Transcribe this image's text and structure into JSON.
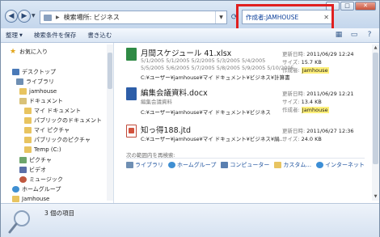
{
  "window": {
    "controls": {
      "minimize": "–",
      "maximize": "□",
      "close": "✕"
    }
  },
  "address_bar": {
    "breadcrumb": "検索場所: ビジネス"
  },
  "search": {
    "value": "作成者:JAMHOUSE",
    "highlight_color": "#e02020"
  },
  "toolbar": {
    "organize": "整理",
    "save_search": "検索条件を保存",
    "burn": "書き込む"
  },
  "sidebar": {
    "items": [
      {
        "label": "お気に入り",
        "icon": "star-icon"
      },
      {
        "label": "デスクトップ",
        "icon": "desktop-icon"
      },
      {
        "label": "ライブラリ",
        "icon": "library-icon"
      },
      {
        "label": "jamhouse",
        "icon": "user-folder-icon"
      },
      {
        "label": "ドキュメント",
        "icon": "documents-icon"
      },
      {
        "label": "マイ ドキュメント",
        "icon": "folder-icon"
      },
      {
        "label": "パブリックのドキュメント",
        "icon": "folder-icon"
      },
      {
        "label": "マイ ピクチャ",
        "icon": "folder-icon"
      },
      {
        "label": "パブリックのピクチャ",
        "icon": "folder-icon"
      },
      {
        "label": "Temp (C:)",
        "icon": "folder-icon"
      },
      {
        "label": "ピクチャ",
        "icon": "pictures-icon"
      },
      {
        "label": "ビデオ",
        "icon": "videos-icon"
      },
      {
        "label": "ミュージック",
        "icon": "music-icon"
      },
      {
        "label": "ホームグループ",
        "icon": "homegroup-icon"
      },
      {
        "label": "Jamhouse",
        "icon": "user-folder-icon"
      }
    ]
  },
  "results": [
    {
      "name": "月間スケジュール 41.xlsx",
      "type": "xlsx",
      "snippet1": "5/1/2005 5/1/2005 5/2/2005 5/3/2005 5/4/2005",
      "snippet2": "5/5/2005 5/6/2005 5/7/2005 5/8/2005 5/9/2005 5/10/2005",
      "path": "C:¥ユーザー¥jamhouse¥マイ ドキュメント¥ビジネス¥計算書",
      "date_key": "更新日時:",
      "date": "2011/06/29 12:24",
      "size_key": "サイズ:",
      "size": "15.7 KB",
      "author_key": "作成者:",
      "author": "Jamhouse"
    },
    {
      "name": "編集会議資料.docx",
      "type": "docx",
      "snippet1": "編集会議資料",
      "path": "C:¥ユーザー¥jamhouse¥マイ ドキュメント¥ビジネス",
      "date_key": "更新日時:",
      "date": "2011/06/29 12:21",
      "size_key": "サイズ:",
      "size": "13.4 KB",
      "author_key": "作成者:",
      "author": "Jamhouse"
    },
    {
      "name": "知っ得188.jtd",
      "type": "jtd",
      "path": "C:¥ユーザー¥jamhouse¥マイ ドキュメント¥ビジネス¥絹...",
      "date_key": "更新日時:",
      "date": "2011/06/27 12:36",
      "size_key": "サイズ:",
      "size": "24.0 KB"
    }
  ],
  "search_again": {
    "label": "次の範囲内を再検索:",
    "locations": [
      {
        "label": "ライブラリ",
        "icon": "library-icon",
        "color": "#6f8fb3"
      },
      {
        "label": "ホームグループ",
        "icon": "homegroup-icon",
        "color": "#3f8fd2"
      },
      {
        "label": "コンピューター",
        "icon": "computer-icon",
        "color": "#5a7fb0"
      },
      {
        "label": "カスタム...",
        "icon": "folder-icon",
        "color": "#e8c460"
      },
      {
        "label": "インターネット",
        "icon": "internet-icon",
        "color": "#3c8ed6"
      }
    ]
  },
  "status": {
    "item_count": "3 個の項目"
  }
}
